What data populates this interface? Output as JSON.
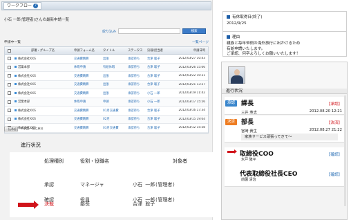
{
  "workflow": {
    "tab_label": "ワークフロー",
    "heading": "小石 一郎(管理者)さんの最新申請一覧",
    "search": {
      "label": "絞り込み",
      "button": "検索"
    },
    "list_label": "申請中一覧",
    "list_more": "一覧ページ",
    "columns": [
      "部署・グループ名",
      "申請フォーム名",
      "タイトル",
      "ステータス",
      "決裁/担当者",
      "申請日時"
    ],
    "rows": [
      {
        "dept": "株式会社XXS",
        "form": "交通費精算",
        "title": "出張",
        "status": "承認待ち",
        "approver": "合津 聡子",
        "date": "2012/03/27 10:43"
      },
      {
        "dept": "営業本部",
        "form": "休暇申請",
        "title": "有給休暇",
        "status": "承認待ち",
        "approver": "合津 聡子",
        "date": "2012/03/26 15:06"
      },
      {
        "dept": "株式会社XXS",
        "form": "交通費精算",
        "title": "出張",
        "status": "承認待ち",
        "approver": "合津 聡子",
        "date": "2012/03/22 10:31"
      },
      {
        "dept": "株式会社XXS",
        "form": "交通費精算",
        "title": "出張",
        "status": "承認待ち",
        "approver": "合津 聡子",
        "date": "2012/03/21 13:27"
      },
      {
        "dept": "株式会社XXS",
        "form": "交通費精算",
        "title": "出張",
        "status": "承認待ち",
        "approver": "小石 一郎",
        "date": "2012/03/19 11:42"
      },
      {
        "dept": "営業本部",
        "form": "休暇申請",
        "title": "申請",
        "status": "承認待ち",
        "approver": "小石 一郎",
        "date": "2012/03/17 15:56"
      },
      {
        "dept": "株式会社XXS",
        "form": "交通費精算",
        "title": "01月交通費",
        "status": "承認待ち",
        "approver": "合津 聡子",
        "date": "2012/03/16 17:34"
      },
      {
        "dept": "株式会社XXS",
        "form": "交通費精算",
        "title": "02月",
        "status": "承認待ち",
        "approver": "合津 聡子",
        "date": "2012/03/15 19:04"
      },
      {
        "dept": "株式会社XXS",
        "form": "交通費精算",
        "title": "03月交通費",
        "status": "承認待ち",
        "approver": "合津 聡子",
        "date": "2012/03/12 15:58"
      }
    ],
    "footer_button": "一括承認",
    "footer_note": "※承認一覧に戻る"
  },
  "status_panel": {
    "title": "進行状況",
    "headers": [
      "処理種別",
      "役割・役職名",
      "対象者"
    ],
    "rows": [
      {
        "type": "承認",
        "role": "マネージャ",
        "person": "小石 一郎(管理者)",
        "active": false
      },
      {
        "type": "決裁",
        "role": "部長",
        "person": "合津 聡子",
        "active": true
      },
      {
        "type": "確認",
        "role": "役員",
        "person": "小石 一郎(管理者)",
        "active": false
      }
    ]
  },
  "mobile": {
    "leave_label": "有休取得日(終了)",
    "leave_date": "2012/9/25",
    "reason_label": "理由",
    "reason_text_1": "親族と毎年恒例の海外旅行に出かけるため",
    "reason_text_2": "有給申請いたします。",
    "reason_text_3": "ご承認、何卒よろしくお願いいたします！",
    "progress_label": "進行状況",
    "steps": [
      {
        "badge": "承認",
        "role": "課長",
        "tag": "【承認】",
        "name": "三井 寿志",
        "date": "2012.08.20 12:21"
      },
      {
        "badge": "決済",
        "role": "部長",
        "tag": "【決済】",
        "name": "宮崎 貴生",
        "date": "2012.08.27 21:22",
        "comment": "家族サービス頑張ってきて〜"
      },
      {
        "role": "取締役COO",
        "tag": "【確認】",
        "name": "水戸 隆平"
      },
      {
        "role": "代表取締役社長CEO",
        "tag": "【確認】",
        "name": "前園 清治"
      }
    ]
  }
}
